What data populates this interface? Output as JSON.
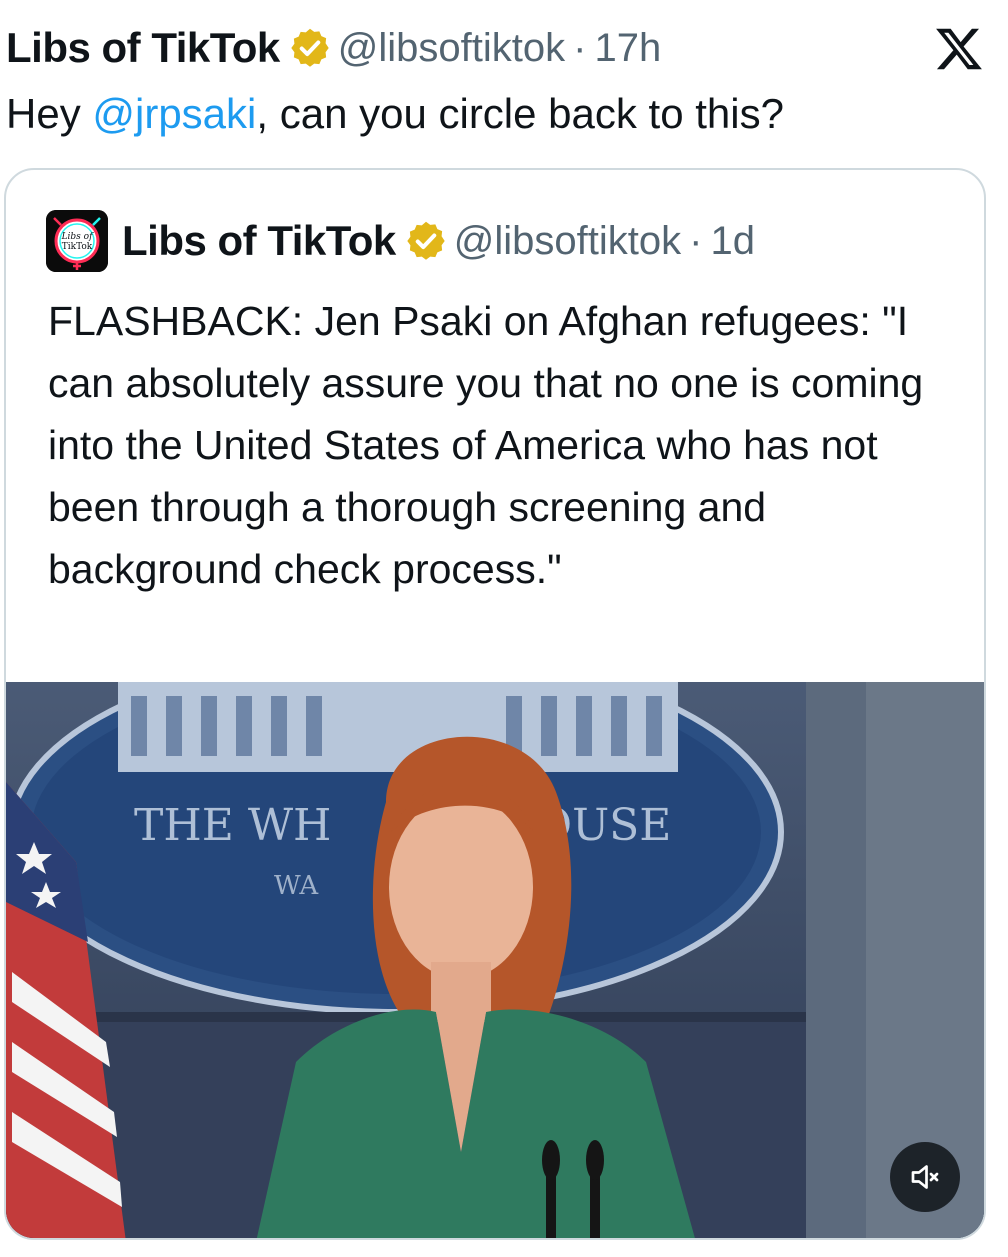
{
  "tweet": {
    "author_name": "Libs of TikTok",
    "handle": "@libsoftiktok",
    "separator": "·",
    "time": "17h",
    "text_prefix": "Hey ",
    "mention": "@jrpsaki",
    "text_suffix": ", can you circle back to this?"
  },
  "quoted": {
    "author_name": "Libs of TikTok",
    "handle": "@libsoftiktok",
    "separator": "·",
    "time": "1d",
    "avatar_text_1": "Libs of",
    "avatar_text_2": "TikTok",
    "text": "FLASHBACK: Jen Psaki on Afghan refugees: \"I can absolutely assure you that no one is coming into the United States of America who has not been through a thorough screening and background check process.\"",
    "media": {
      "seal_text_1": "THE WH",
      "seal_text_2": "OUSE",
      "seal_text_3": "WA"
    }
  },
  "icons": {
    "verified": "verified-badge-icon",
    "platform": "x-logo-icon",
    "mute": "volume-muted-icon"
  },
  "colors": {
    "link": "#1d9bf0",
    "verified": "#e2b719",
    "muted_text": "#536471"
  }
}
